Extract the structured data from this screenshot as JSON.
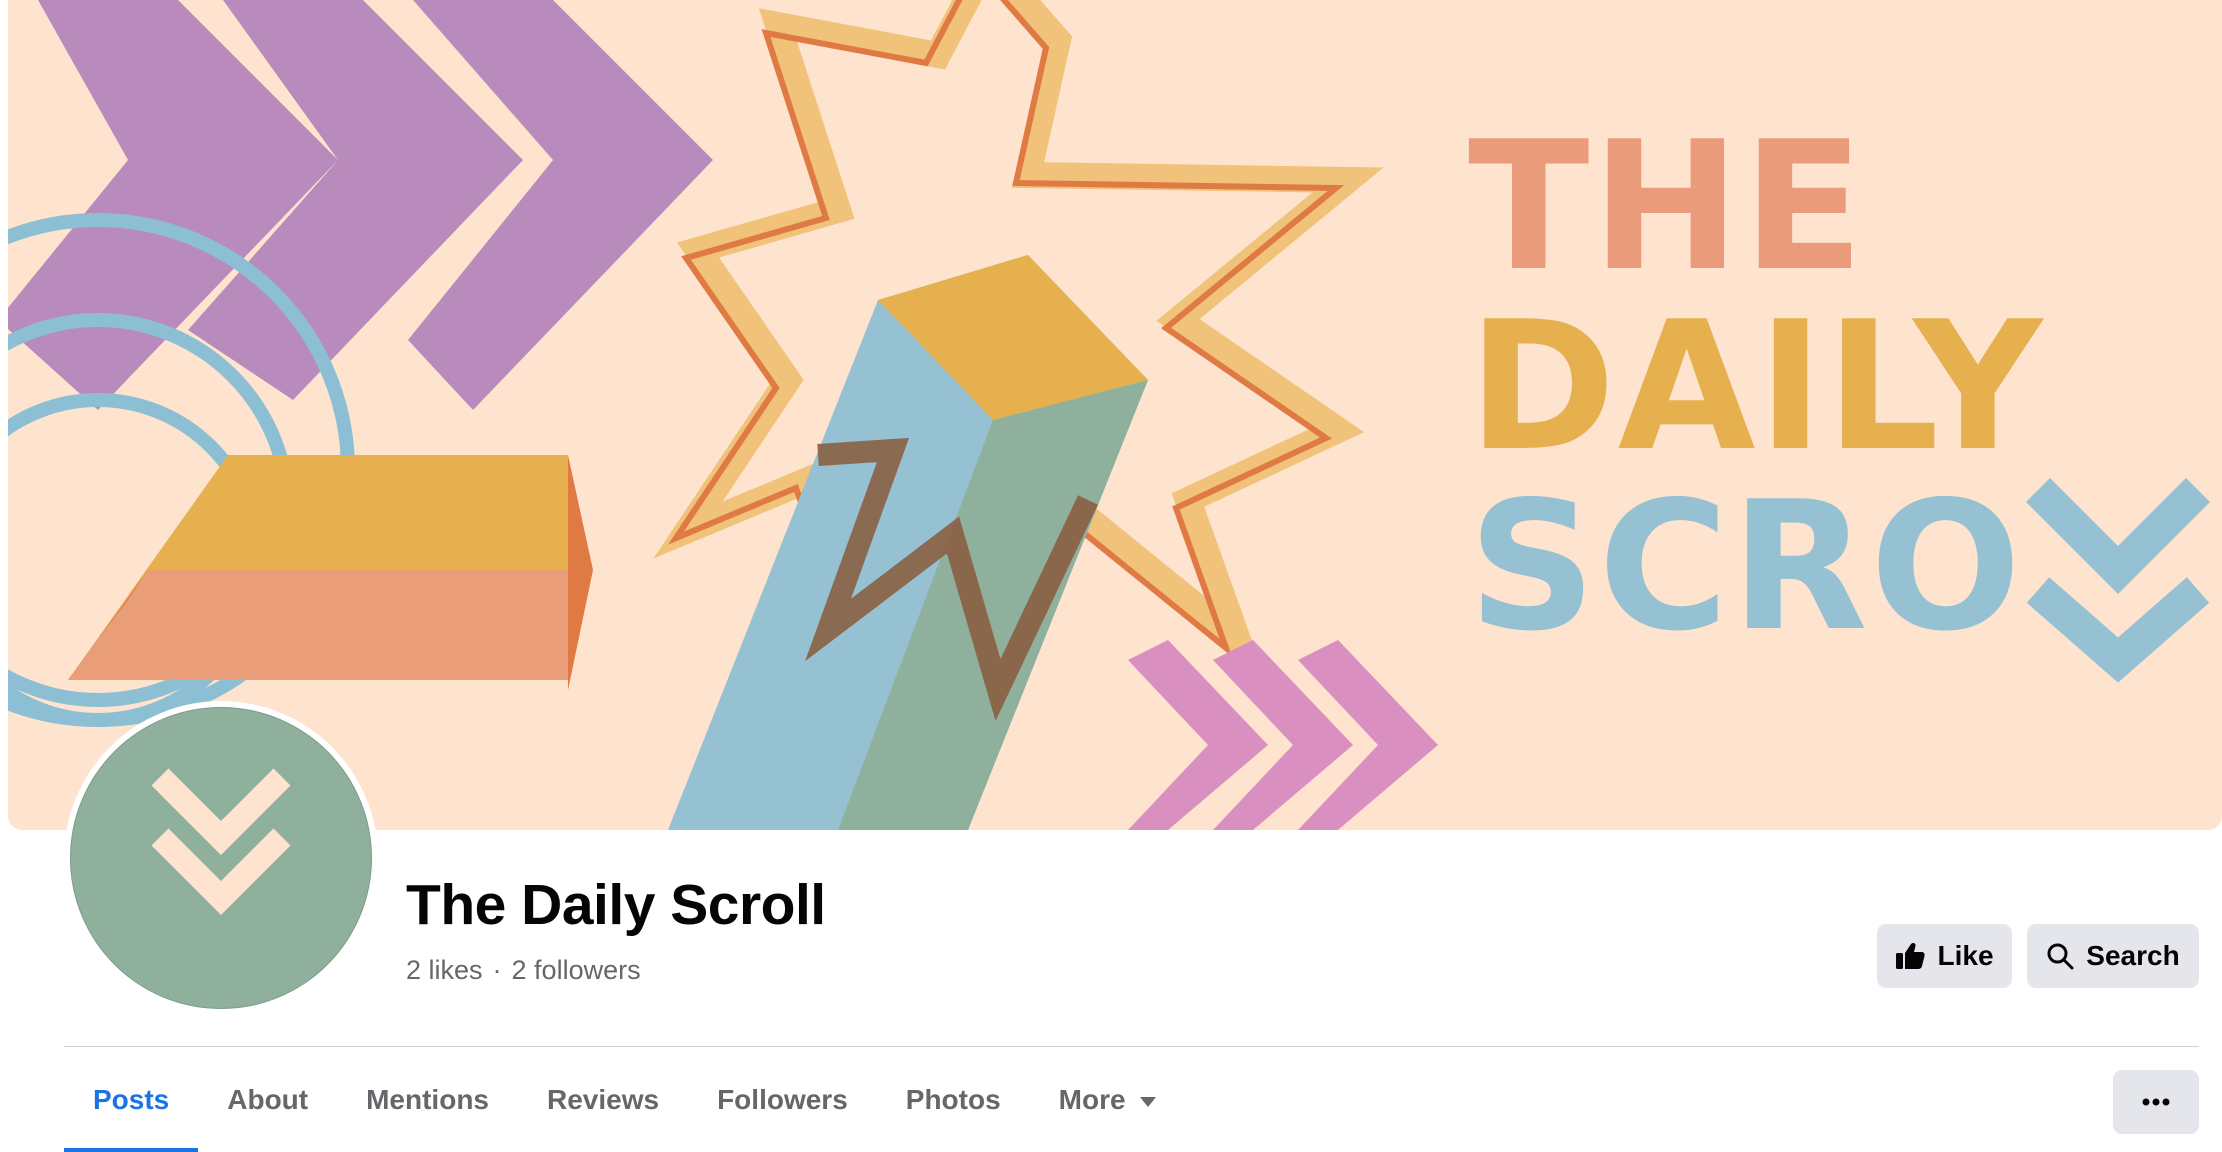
{
  "cover": {
    "title_lines": [
      "THE",
      "DAILY",
      "SCRO"
    ]
  },
  "page": {
    "name": "The Daily Scroll",
    "likes": "2 likes",
    "separator": "·",
    "followers": "2 followers"
  },
  "actions": {
    "like_label": "Like",
    "search_label": "Search",
    "more_label": "..."
  },
  "tabs": [
    {
      "label": "Posts",
      "active": true
    },
    {
      "label": "About"
    },
    {
      "label": "Mentions"
    },
    {
      "label": "Reviews"
    },
    {
      "label": "Followers"
    },
    {
      "label": "Photos"
    },
    {
      "label": "More"
    }
  ],
  "icons": {
    "like": "thumbs-up-icon",
    "search": "search-icon",
    "more_tab": "caret-down-icon",
    "overflow": "ellipsis-icon"
  },
  "colors": {
    "cover_bg": "#fee4cf",
    "accent_blue": "#1b74e4",
    "button_bg": "#e4e6eb",
    "muted_text": "#65676b",
    "avatar_bg": "#8fb09c"
  }
}
